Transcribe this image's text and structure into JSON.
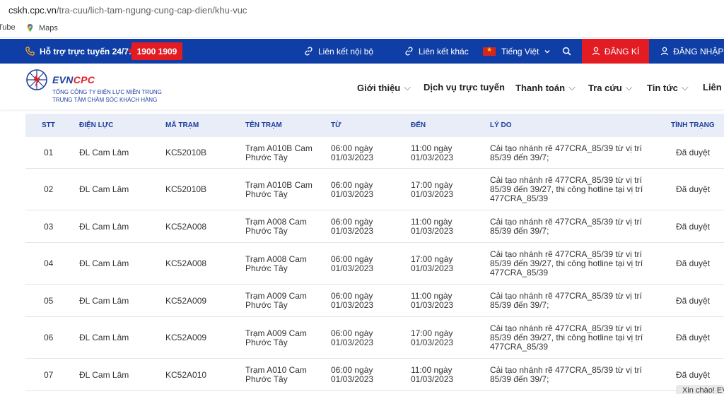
{
  "browser": {
    "url_domain": "cskh.cpc.vn",
    "url_path": "/tra-cuu/lich-tam-ngung-cung-cap-dien/khu-vuc",
    "bookmarks": [
      "Tube",
      "Maps"
    ]
  },
  "topbar": {
    "support_label": "Hỗ trợ trực tuyến 24/7:",
    "hotline": "1900 1909",
    "internal_links": "Liên kết nội bộ",
    "external_links": "Liên kết khác",
    "language": "Tiếng Việt",
    "register": "ĐĂNG KÍ",
    "login": "ĐĂNG NHẬP"
  },
  "logo": {
    "evn": "EVN",
    "cpc": "CPC",
    "line1": "TỔNG CÔNG TY ĐIỆN LỰC MIỀN TRUNG",
    "line2": "TRUNG TÂM CHĂM SÓC KHÁCH HÀNG"
  },
  "nav": [
    "Giới thiệu",
    "Dịch vụ trực tuyến",
    "Thanh toán",
    "Tra cứu",
    "Tin tức",
    "Liên l"
  ],
  "table": {
    "headers": [
      "STT",
      "ĐIỆN LỰC",
      "MÃ TRẠM",
      "TÊN TRẠM",
      "TỪ",
      "ĐẾN",
      "LÝ DO",
      "TÌNH TRẠNG"
    ],
    "rows": [
      {
        "stt": "01",
        "dien_luc": "ĐL Cam Lâm",
        "ma_tram": "KC52010B",
        "ten_tram": "Trạm A010B Cam Phước Tây",
        "tu": "06:00 ngày 01/03/2023",
        "den": "11:00 ngày 01/03/2023",
        "ly_do": "Cải tạo nhánh rẽ 477CRA_85/39 từ vị trí 85/39 đến 39/7;",
        "tinh_trang": "Đã duyệt"
      },
      {
        "stt": "02",
        "dien_luc": "ĐL Cam Lâm",
        "ma_tram": "KC52010B",
        "ten_tram": "Trạm A010B Cam Phước Tây",
        "tu": "06:00 ngày 01/03/2023",
        "den": "17:00 ngày 01/03/2023",
        "ly_do": "Cải tạo nhánh rẽ 477CRA_85/39 từ vị trí 85/39 đến 39/27, thi công hotline tại vị trí 477CRA_85/39",
        "tinh_trang": "Đã duyệt"
      },
      {
        "stt": "03",
        "dien_luc": "ĐL Cam Lâm",
        "ma_tram": "KC52A008",
        "ten_tram": "Trạm A008 Cam Phước Tây",
        "tu": "06:00 ngày 01/03/2023",
        "den": "11:00 ngày 01/03/2023",
        "ly_do": "Cải tạo nhánh rẽ 477CRA_85/39 từ vị trí 85/39 đến 39/7;",
        "tinh_trang": "Đã duyệt"
      },
      {
        "stt": "04",
        "dien_luc": "ĐL Cam Lâm",
        "ma_tram": "KC52A008",
        "ten_tram": "Trạm A008 Cam Phước Tây",
        "tu": "06:00 ngày 01/03/2023",
        "den": "17:00 ngày 01/03/2023",
        "ly_do": "Cải tạo nhánh rẽ 477CRA_85/39 từ vị trí 85/39 đến 39/27, thi công hotline tại vị trí 477CRA_85/39",
        "tinh_trang": "Đã duyệt"
      },
      {
        "stt": "05",
        "dien_luc": "ĐL Cam Lâm",
        "ma_tram": "KC52A009",
        "ten_tram": "Trạm A009 Cam Phước Tây",
        "tu": "06:00 ngày 01/03/2023",
        "den": "11:00 ngày 01/03/2023",
        "ly_do": "Cải tạo nhánh rẽ 477CRA_85/39 từ vị trí 85/39 đến 39/7;",
        "tinh_trang": "Đã duyệt"
      },
      {
        "stt": "06",
        "dien_luc": "ĐL Cam Lâm",
        "ma_tram": "KC52A009",
        "ten_tram": "Trạm A009 Cam Phước Tây",
        "tu": "06:00 ngày 01/03/2023",
        "den": "17:00 ngày 01/03/2023",
        "ly_do": "Cải tạo nhánh rẽ 477CRA_85/39 từ vị trí 85/39 đến 39/27, thi công hotline tại vị trí 477CRA_85/39",
        "tinh_trang": "Đã duyệt"
      },
      {
        "stt": "07",
        "dien_luc": "ĐL Cam Lâm",
        "ma_tram": "KC52A010",
        "ten_tram": "Trạm A010 Cam Phước Tây",
        "tu": "06:00 ngày 01/03/2023",
        "den": "11:00 ngày 01/03/2023",
        "ly_do": "Cải tạo nhánh rẽ 477CRA_85/39 từ vị trí 85/39 đến 39/7;",
        "tinh_trang": "Đã duyệt"
      }
    ]
  },
  "chat_tab": "Xin chào! EV"
}
